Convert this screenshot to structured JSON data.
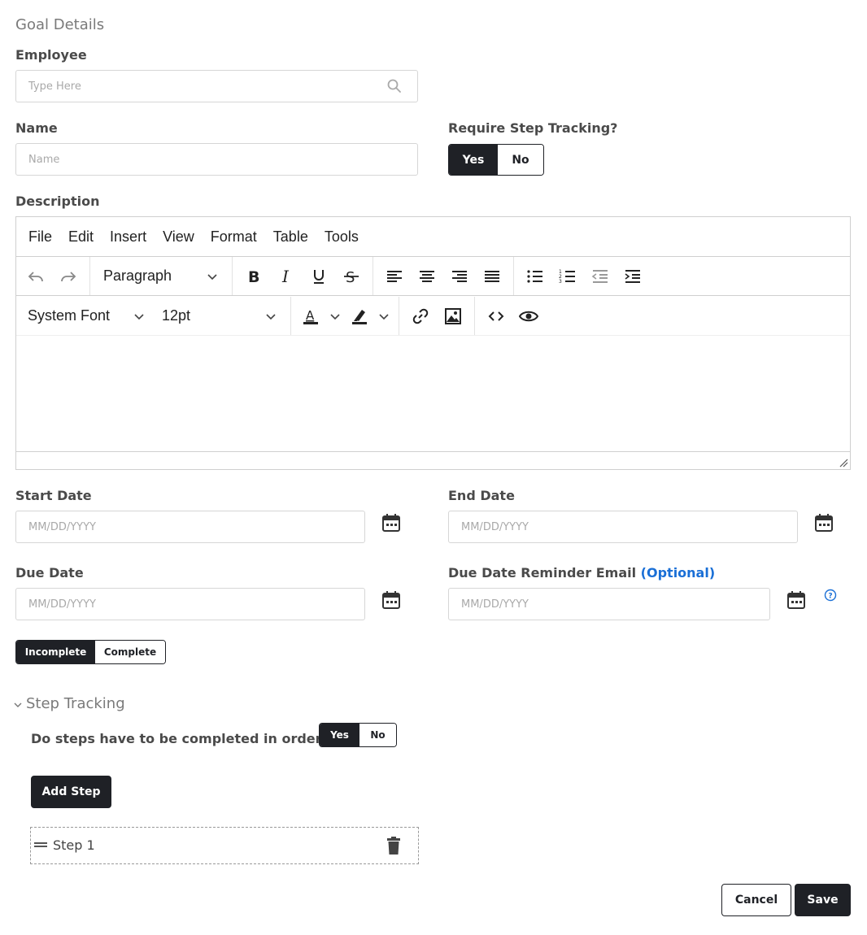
{
  "header": {
    "title": "Goal Details"
  },
  "employee": {
    "label": "Employee",
    "placeholder": "Type Here"
  },
  "name": {
    "label": "Name",
    "placeholder": "Name"
  },
  "require_step": {
    "label": "Require Step Tracking?",
    "yes": "Yes",
    "no": "No",
    "selected": "Yes"
  },
  "description": {
    "label": "Description",
    "menu": [
      "File",
      "Edit",
      "Insert",
      "View",
      "Format",
      "Table",
      "Tools"
    ],
    "block_format": "Paragraph",
    "font_family": "System Font",
    "font_size": "12pt",
    "content": ""
  },
  "start_date": {
    "label": "Start Date",
    "placeholder": "MM/DD/YYYY"
  },
  "end_date": {
    "label": "End Date",
    "placeholder": "MM/DD/YYYY"
  },
  "due_date": {
    "label": "Due Date",
    "placeholder": "MM/DD/YYYY"
  },
  "reminder": {
    "label": "Due Date Reminder Email",
    "optional": "(Optional)",
    "placeholder": "MM/DD/YYYY",
    "accent": "#1a6fd6"
  },
  "status": {
    "incomplete": "Incomplete",
    "complete": "Complete",
    "selected": "Incomplete"
  },
  "step_tracking": {
    "title": "Step Tracking",
    "order_question": "Do steps have to be completed in order?",
    "yes": "Yes",
    "no": "No",
    "selected": "Yes",
    "add_step": "Add Step",
    "steps": [
      {
        "label": "Step 1"
      }
    ]
  },
  "actions": {
    "cancel": "Cancel",
    "save": "Save"
  },
  "colors": {
    "dark": "#1f2126",
    "border": "#d6d6d6",
    "accent": "#1a6fd6"
  }
}
